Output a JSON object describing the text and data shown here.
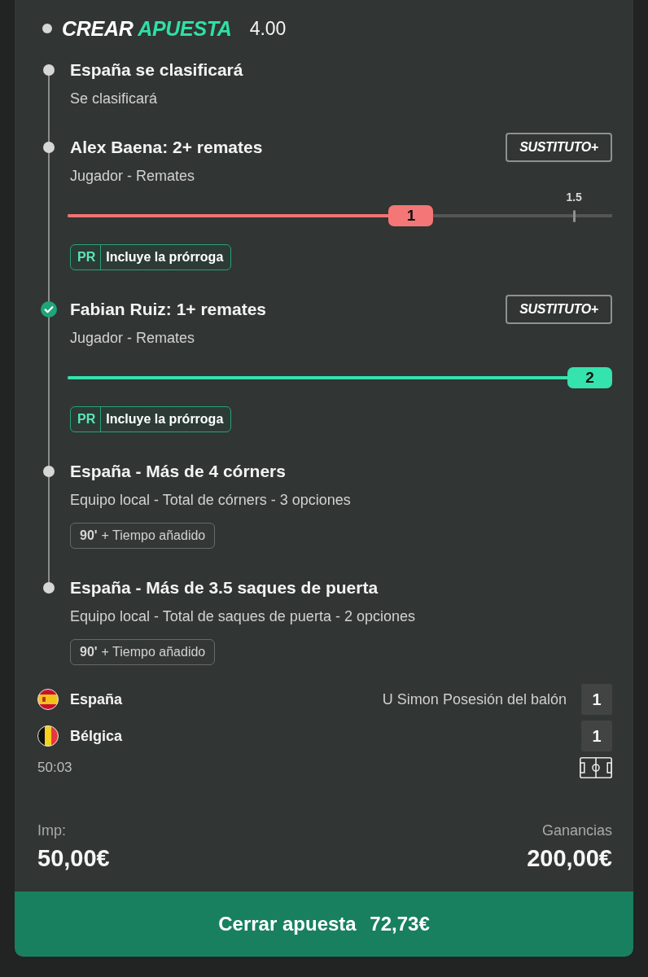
{
  "header": {
    "title": {
      "prefix": "CREAR",
      "accent": "APUESTA"
    },
    "odds": "4.00"
  },
  "legs": [
    {
      "won": false,
      "title": "España se clasificará",
      "subtitle": "Se clasificará"
    },
    {
      "won": false,
      "title": "Alex Baena: 2+ remates",
      "subtitle": "Jugador - Remates",
      "substitute_button": "SUSTITUTO+",
      "tracker": {
        "level": 0.63,
        "value": "1",
        "target": {
          "label": "1.5",
          "level": 0.93
        }
      },
      "badge": {
        "kind": "extended",
        "code": "PR",
        "label": "Incluye la prórroga"
      }
    },
    {
      "won": true,
      "title": "Fabian Ruiz: 1+ remates",
      "subtitle": "Jugador - Remates",
      "substitute_button": "SUSTITUTO+",
      "tracker": {
        "level": 1,
        "value": "2"
      },
      "badge": {
        "kind": "extended",
        "code": "PR",
        "label": "Incluye la prórroga"
      }
    },
    {
      "won": false,
      "title": "España - Más de 4 córners",
      "subtitle": "Equipo local - Total de córners - 3 opciones",
      "badge": {
        "kind": "regulation",
        "code": "90'",
        "label": "+ Tiempo añadido"
      }
    },
    {
      "won": false,
      "title": "España - Más de 3.5 saques de puerta",
      "subtitle": "Equipo local - Total de saques de puerta - 2 opciones",
      "badge": {
        "kind": "regulation",
        "code": "90'",
        "label": "+ Tiempo añadido"
      }
    }
  ],
  "scoreboard": {
    "teams": [
      {
        "kind": "spain",
        "name": "España",
        "stat": "U Simon Posesión del balón",
        "score": "1"
      },
      {
        "kind": "belgium",
        "name": "Bélgica",
        "score": "1"
      }
    ],
    "clock": "50:03"
  },
  "totals": {
    "stake_label": "Imp:",
    "stake": "50,00€",
    "returns_label": "Ganancias",
    "returns": "200,00€"
  },
  "cash_out": {
    "label": "Cerrar apuesta",
    "amount": "72,73€"
  }
}
